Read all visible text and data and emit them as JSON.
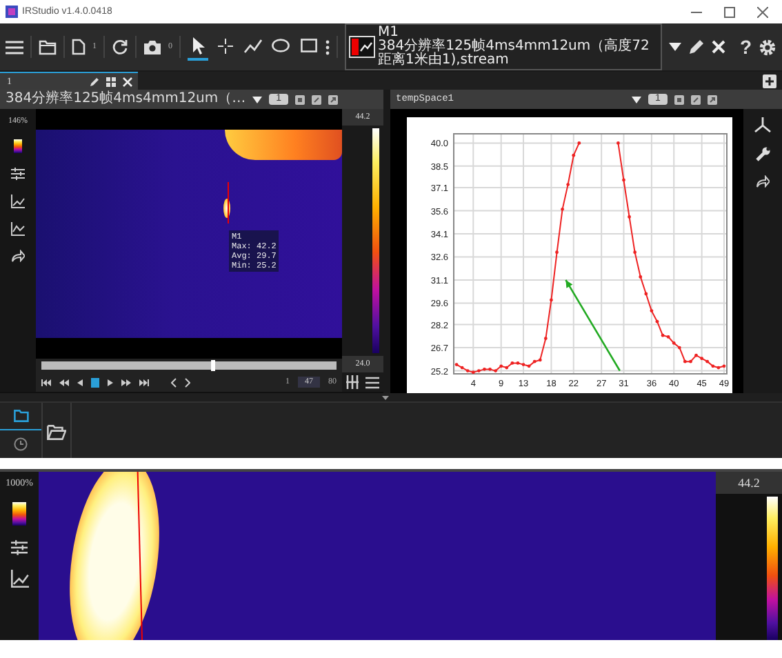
{
  "window": {
    "title": "IRStudio v1.4.0.0418"
  },
  "toolbar": {
    "file_count": "1",
    "snapshot_count": "0",
    "tools": [
      {
        "kind": "pointer",
        "selected": true
      },
      {
        "kind": "point",
        "selected": false
      },
      {
        "kind": "polyline",
        "selected": false
      },
      {
        "kind": "ellipse",
        "selected": false
      },
      {
        "kind": "rectangle",
        "selected": false
      }
    ],
    "measurement": {
      "name": "M1",
      "color": "#ee0000",
      "source": "384分辨率125帧4ms4mm12um（高度72距离1米由1),stream"
    },
    "help": "?"
  },
  "tabs": [
    {
      "label": "1",
      "selected": true
    }
  ],
  "left_panel": {
    "source": "384分辨率125帧4ms4mm12um（…",
    "badge": "1",
    "zoom": "146%",
    "scale_max": "44.2",
    "scale_min": "24.0",
    "measurement": {
      "name": "M1",
      "lines": [
        "Max: 42.2",
        "Avg: 29.7",
        "Min: 25.2"
      ]
    },
    "playback": {
      "level": 0.58,
      "frame_start": "1",
      "frame_current": "47",
      "frame_total": "80"
    }
  },
  "right_panel": {
    "source": "tempSpace1",
    "badge": "1",
    "chart_data": {
      "type": "line",
      "x": [
        1,
        2,
        3,
        4,
        5,
        6,
        7,
        8,
        9,
        10,
        11,
        12,
        13,
        14,
        15,
        16,
        17,
        18,
        19,
        20,
        21,
        22,
        23,
        24,
        25,
        26,
        27,
        28,
        29,
        30,
        31,
        32,
        33,
        34,
        35,
        36,
        37,
        38,
        39,
        40,
        41,
        42,
        43,
        44,
        45,
        46,
        47,
        48,
        49
      ],
      "series": [
        {
          "color": "#ee2222",
          "values": [
            25.6,
            25.4,
            25.2,
            25.1,
            25.2,
            25.3,
            25.3,
            25.2,
            25.5,
            25.4,
            25.7,
            25.7,
            25.6,
            25.5,
            25.8,
            25.9,
            27.3,
            29.8,
            32.9,
            35.7,
            37.3,
            39.2,
            40.0,
            null,
            null,
            null,
            null,
            null,
            null,
            40.0,
            37.6,
            35.2,
            32.9,
            31.3,
            30.2,
            29.1,
            28.4,
            27.5,
            27.4,
            27.0,
            26.7,
            25.8,
            25.8,
            26.2,
            26.0,
            25.8,
            25.5,
            25.4,
            25.5
          ]
        }
      ],
      "grid": true,
      "xlim": [
        0.5,
        49.5
      ],
      "ylim": [
        25.0,
        40.6
      ],
      "xticks": [
        4,
        9,
        13,
        18,
        22,
        27,
        31,
        36,
        40,
        45,
        49
      ],
      "yticks": [
        {
          "value": 25.2,
          "label": "25.2"
        },
        {
          "value": 26.7,
          "label": "26.7"
        },
        {
          "value": 28.2,
          "label": "28.2"
        },
        {
          "value": 29.6,
          "label": "29.6"
        },
        {
          "value": 31.1,
          "label": "31.1"
        },
        {
          "value": 32.6,
          "label": "32.6"
        },
        {
          "value": 34.1,
          "label": "34.1"
        },
        {
          "value": 35.6,
          "label": "35.6"
        },
        {
          "value": 37.1,
          "label": "37.1"
        },
        {
          "value": 38.5,
          "label": "38.5"
        },
        {
          "value": 40.0,
          "label": "40.0"
        }
      ]
    }
  },
  "bottom_panel": {
    "tabs": [
      {
        "kind": "files",
        "selected": true
      },
      {
        "kind": "history",
        "selected": false
      }
    ]
  },
  "detail_view": {
    "zoom": "1000%",
    "scale_max": "44.2"
  }
}
